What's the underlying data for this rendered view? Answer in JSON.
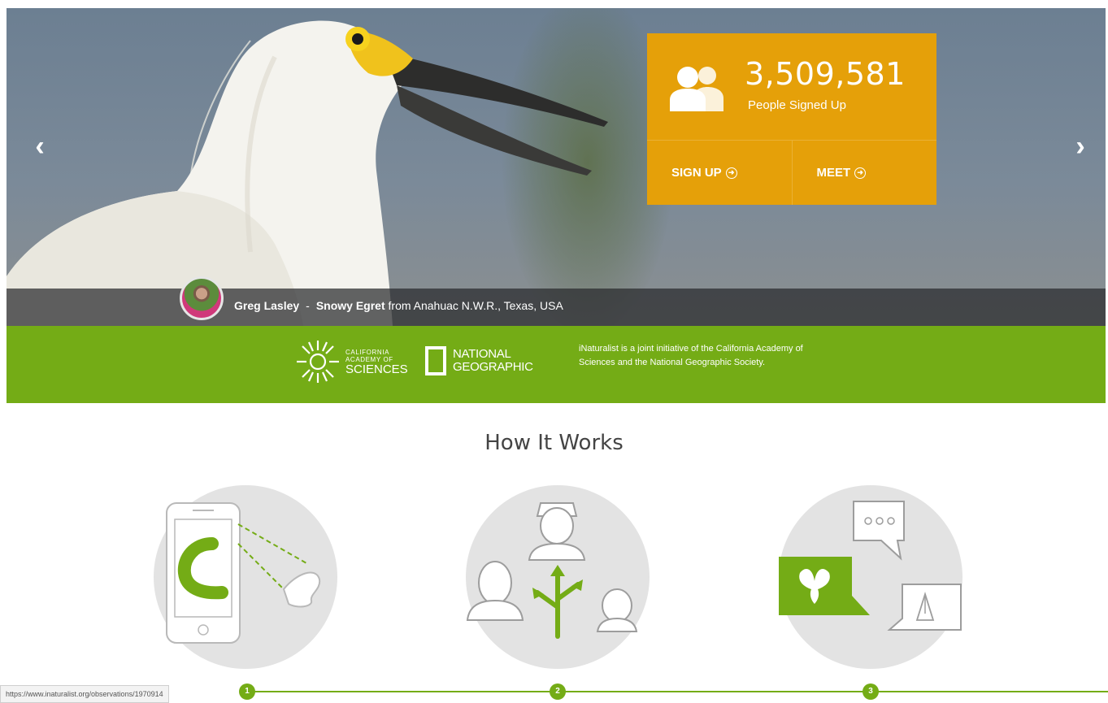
{
  "hero": {
    "prev_arrow": "‹",
    "next_arrow": "›",
    "stats": {
      "count": "3,509,581",
      "label": "People Signed Up"
    },
    "signup_label": "SIGN UP",
    "meet_label": "MEET",
    "caption": {
      "photographer": "Greg Lasley",
      "separator": "-",
      "species": "Snowy Egret",
      "location": "from Anahuac N.W.R., Texas, USA"
    }
  },
  "partners": {
    "cas": {
      "line1": "CALIFORNIA",
      "line2": "ACADEMY OF",
      "line3": "SCIENCES"
    },
    "natgeo": {
      "line1": "NATIONAL",
      "line2": "GEOGRAPHIC"
    },
    "description": "iNaturalist is a joint initiative of the California Academy of Sciences and the National Geographic Society."
  },
  "how_it_works": {
    "title": "How It Works",
    "steps": [
      {
        "number": "1",
        "icon": "phone-observation-icon"
      },
      {
        "number": "2",
        "icon": "community-share-icon"
      },
      {
        "number": "3",
        "icon": "identification-discussion-icon"
      }
    ]
  },
  "status_bar": {
    "url": "https://www.inaturalist.org/observations/1970914"
  },
  "colors": {
    "accent_orange": "#e5a009",
    "brand_green": "#74ac16"
  }
}
